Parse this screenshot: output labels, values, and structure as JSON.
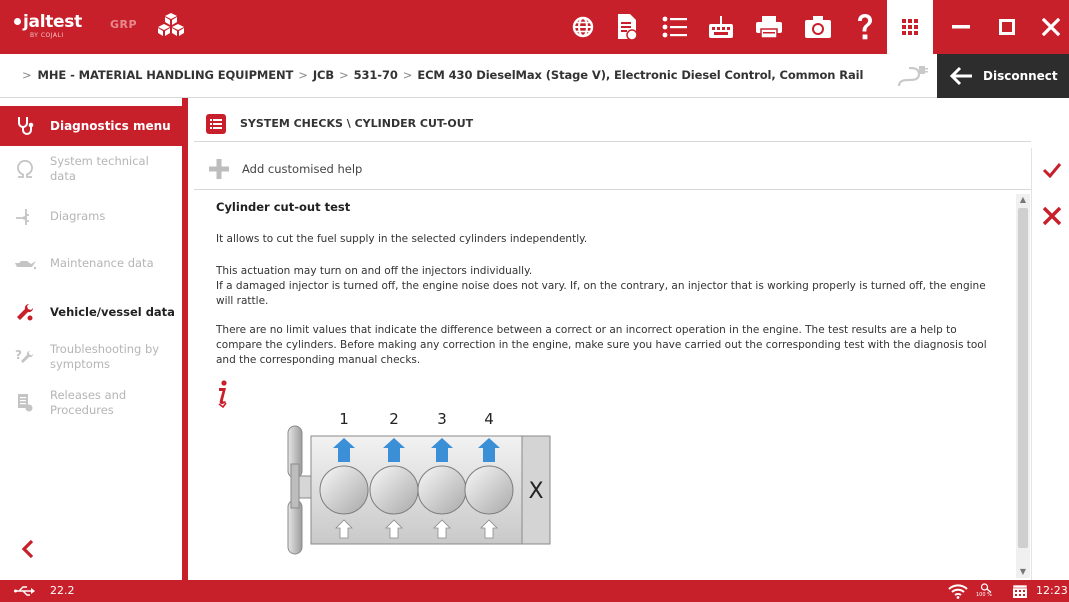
{
  "app": {
    "logo_text": "jaltest",
    "logo_sub": "BY COJALI",
    "logo_tag": "GRP"
  },
  "toolbar": {
    "icons": [
      "globe-icon",
      "document-icon",
      "list-icon",
      "keyboard-icon",
      "printer-icon",
      "camera-icon",
      "help-icon",
      "apps-grid-icon"
    ],
    "window": [
      "minimize-icon",
      "maximize-icon",
      "close-icon"
    ]
  },
  "breadcrumb": {
    "items": [
      "MHE - MATERIAL HANDLING EQUIPMENT",
      "JCB",
      "531-70",
      "ECM 430 DieselMax (Stage V), Electronic Diesel Control, Common Rail"
    ],
    "disconnect_label": "Disconnect"
  },
  "sidebar": {
    "header": "Diagnostics menu",
    "items": [
      {
        "label": "System technical data",
        "active": false
      },
      {
        "label": "Diagrams",
        "active": false
      },
      {
        "label": "Maintenance data",
        "active": false
      },
      {
        "label": "Vehicle/vessel data",
        "active": true
      },
      {
        "label": "Troubleshooting by symptoms",
        "active": false
      },
      {
        "label": "Releases and Procedures",
        "active": false
      }
    ]
  },
  "main": {
    "title": "SYSTEM CHECKS \\ CYLINDER CUT-OUT",
    "add_help": "Add customised help",
    "heading": "Cylinder cut-out test",
    "p1": "It allows to cut the fuel supply in the selected cylinders independently.",
    "p2a": "This actuation may turn on and off the injectors individually.",
    "p2b": "If a damaged injector is turned off, the engine noise does not vary. If, on the contrary, an injector that is working properly is turned off, the engine will rattle.",
    "p3": "There are no limit values that indicate the difference between a correct or an incorrect operation in the engine. The test results are a help to compare the cylinders. Before making any correction in the engine, make sure you have carried out the corresponding test with the diagnosis tool and the corresponding manual checks.",
    "diagram": {
      "cylinders": [
        "1",
        "2",
        "3",
        "4"
      ],
      "mark": "X"
    }
  },
  "status": {
    "voltage": "22.2",
    "zoom": "100 %",
    "time": "12:23"
  },
  "colors": {
    "brand_red": "#c8202b",
    "dark": "#2d2d2d"
  }
}
